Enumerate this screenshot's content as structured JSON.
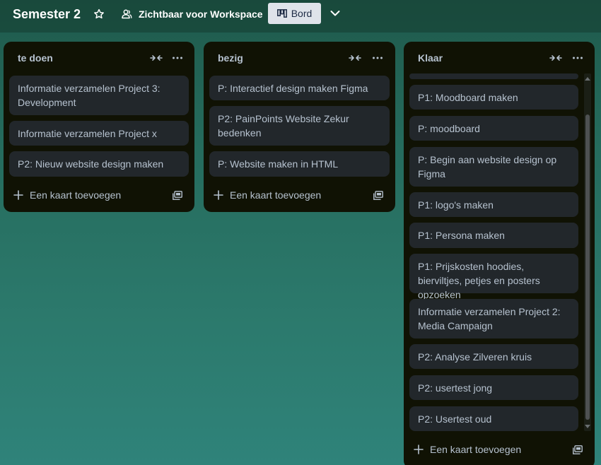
{
  "header": {
    "board_title": "Semester 2",
    "visibility_label": "Zichtbaar voor Workspace",
    "view_label": "Bord"
  },
  "lists": [
    {
      "title": "te doen",
      "cards": [
        "Informatie verzamelen Project 3: Development",
        "Informatie verzamelen Project x",
        "P2: Nieuw website design maken"
      ],
      "add_card_label": "Een kaart toevoegen"
    },
    {
      "title": "bezig",
      "cards": [
        "P: Interactief design maken Figma",
        "P2: PainPoints Website Zekur bedenken",
        "P: Website maken in HTML"
      ],
      "add_card_label": "Een kaart toevoegen"
    },
    {
      "title": "Klaar",
      "cards": [
        "P1: Moodboard maken",
        "P: moodboard",
        "P: Begin aan website design op Figma",
        "P1: logo's maken",
        "P1: Persona maken",
        "P1: Prijskosten hoodies, bierviltjes, petjes en posters opzoeken",
        "Informatie verzamelen Project 2: Media Campaign",
        "P2: Analyse Zilveren kruis",
        "P2: usertest jong",
        "P2: Usertest oud"
      ],
      "add_card_label": "Een kaart toevoegen"
    }
  ],
  "icons": {
    "star": "star-icon",
    "visibility": "people-icon",
    "view": "board-icon",
    "chevron": "chevron-down-icon",
    "collapse": "collapse-icon",
    "more": "more-icon",
    "add": "plus-icon",
    "template": "template-icon"
  },
  "colors": {
    "list_bg": "#101204",
    "card_bg": "#22272b",
    "text": "#b6c2cf",
    "view_button_bg": "#dfe3ea"
  }
}
